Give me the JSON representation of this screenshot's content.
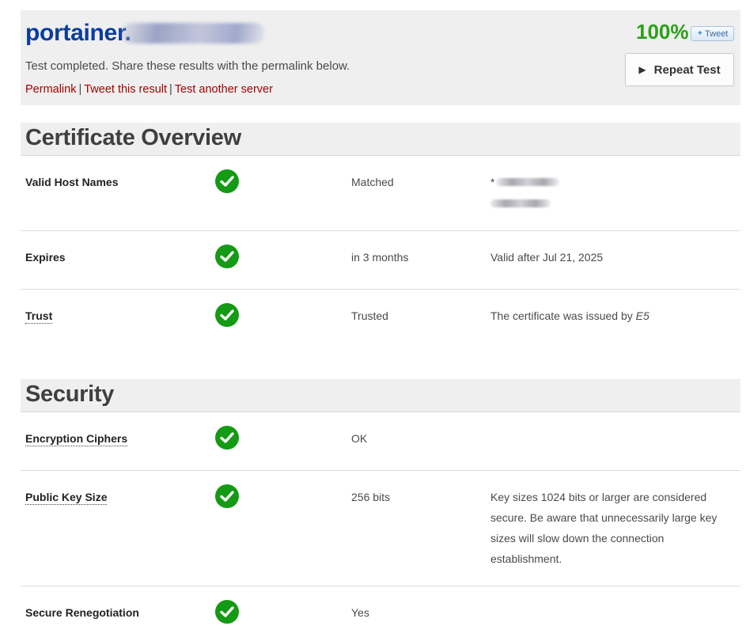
{
  "header": {
    "host": "portainer.",
    "status_text": "Test completed. Share these results with the permalink below.",
    "links": [
      "Permalink",
      "Tweet this result",
      "Test another server"
    ],
    "link_separator": "|",
    "score": "100%",
    "tweet_label": "Tweet",
    "repeat_button_label": "Repeat Test",
    "colors": {
      "host": "#0b3c9e",
      "score": "#2aa01a",
      "links": "#a60000",
      "check": "#149a14"
    }
  },
  "certificate_overview": {
    "title": "Certificate Overview",
    "rows": [
      {
        "label": "Valid Host Names",
        "status": "Matched",
        "detail_prefix": "*"
      },
      {
        "label": "Expires",
        "status": "in 3 months",
        "detail": "Valid after Jul 21, 2025"
      },
      {
        "label": "Trust",
        "status": "Trusted",
        "detail_prefix": "The certificate was issued by ",
        "issuer": "E5"
      }
    ]
  },
  "security": {
    "title": "Security",
    "rows": [
      {
        "label": "Encryption Ciphers",
        "status": "OK"
      },
      {
        "label": "Public Key Size",
        "status": "256 bits",
        "detail": "Key sizes 1024 bits or larger are considered secure. Be aware that unnecessarily large key sizes will slow down the connection establishment."
      },
      {
        "label": "Secure Renegotiation",
        "status": "Yes"
      }
    ]
  },
  "icons": {
    "check": "check-circle-icon",
    "play": "play-icon",
    "twitter": "twitter-bird-icon"
  }
}
